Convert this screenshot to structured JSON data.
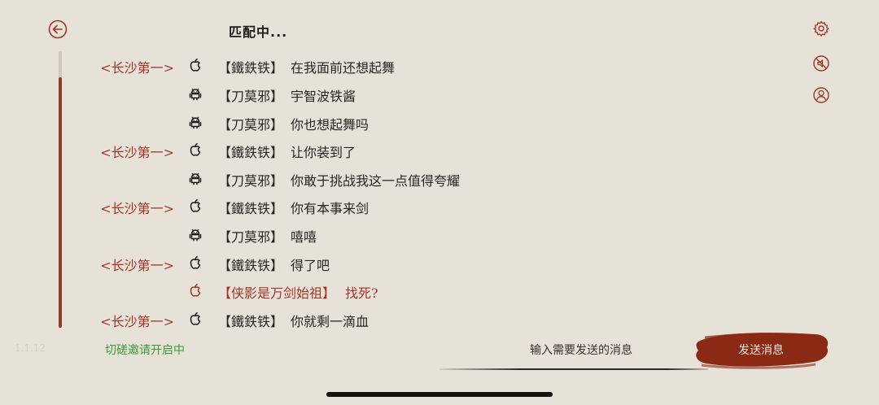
{
  "header": {
    "title": "匹配中..."
  },
  "icons": {
    "back": "back-arrow-icon",
    "settings": "gear-icon",
    "sound": "sound-off-icon",
    "profile": "user-icon"
  },
  "colors": {
    "accent": "#a1352a",
    "send_button": "#8b2a14",
    "invite": "#3e9a3a",
    "background": "#e6e2d8"
  },
  "messages": [
    {
      "tag": "<长沙第一>",
      "platform": "apple",
      "name": "【鐵鉄铁】",
      "text": "在我面前还想起舞"
    },
    {
      "tag": "",
      "platform": "android",
      "name": "【刀莫邪】",
      "text": "宇智波铁酱"
    },
    {
      "tag": "",
      "platform": "android",
      "name": "【刀莫邪】",
      "text": "你也想起舞吗"
    },
    {
      "tag": "<长沙第一>",
      "platform": "apple",
      "name": "【鐵鉄铁】",
      "text": "让你装到了"
    },
    {
      "tag": "",
      "platform": "android",
      "name": "【刀莫邪】",
      "text": "你敢于挑战我这一点值得夸耀"
    },
    {
      "tag": "<长沙第一>",
      "platform": "apple",
      "name": "【鐵鉄铁】",
      "text": "你有本事来剑"
    },
    {
      "tag": "",
      "platform": "android",
      "name": "【刀莫邪】",
      "text": "嘻嘻"
    },
    {
      "tag": "<长沙第一>",
      "platform": "apple",
      "name": "【鐵鉄铁】",
      "text": "得了吧"
    },
    {
      "tag": "",
      "platform": "apple",
      "name": "【侠影是万剑始祖】",
      "text": "找死?",
      "highlight": true
    },
    {
      "tag": "<长沙第一>",
      "platform": "apple",
      "name": "【鐵鉄铁】",
      "text": "你就剩一滴血"
    }
  ],
  "footer": {
    "version": "1.1.12",
    "invite_status": "切磋邀请开启中",
    "input_placeholder": "输入需要发送的消息",
    "send_label": "发送消息"
  }
}
